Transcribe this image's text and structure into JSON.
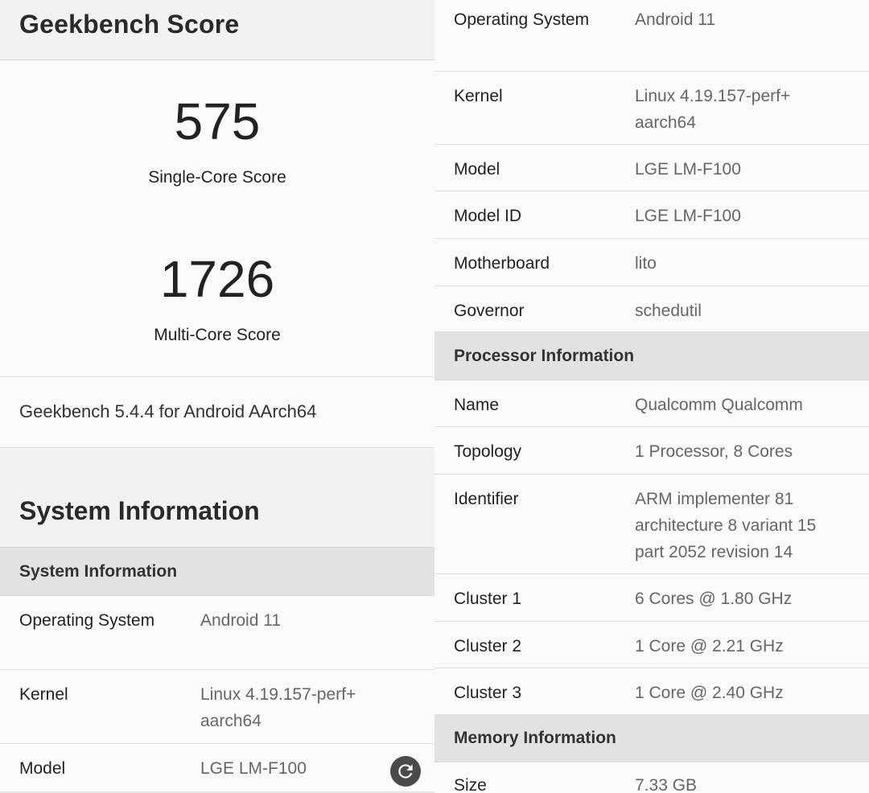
{
  "left": {
    "header_title": "Geekbench Score",
    "single_score": "575",
    "single_label": "Single-Core Score",
    "multi_score": "1726",
    "multi_label": "Multi-Core Score",
    "version": "Geekbench 5.4.4 for Android AArch64",
    "section_title": "System Information",
    "subheader": "System Information",
    "rows": [
      {
        "key": "Operating System",
        "value": "Android 11"
      },
      {
        "key": "Kernel",
        "value": "Linux 4.19.157-perf+ aarch64"
      },
      {
        "key": "Model",
        "value": "LGE LM-F100"
      }
    ]
  },
  "right": {
    "system_rows": [
      {
        "key": "Operating System",
        "value": "Android 11"
      },
      {
        "key": "Kernel",
        "value": "Linux 4.19.157-perf+ aarch64"
      },
      {
        "key": "Model",
        "value": "LGE LM-F100"
      },
      {
        "key": "Model ID",
        "value": "LGE LM-F100"
      },
      {
        "key": "Motherboard",
        "value": "lito"
      },
      {
        "key": "Governor",
        "value": "schedutil"
      }
    ],
    "processor_header": "Processor Information",
    "processor_rows": [
      {
        "key": "Name",
        "value": "Qualcomm Qualcomm"
      },
      {
        "key": "Topology",
        "value": "1 Processor, 8 Cores"
      },
      {
        "key": "Identifier",
        "value": "ARM implementer 81 architecture 8 variant 15 part 2052 revision 14"
      },
      {
        "key": "Cluster 1",
        "value": "6 Cores @ 1.80 GHz"
      },
      {
        "key": "Cluster 2",
        "value": "1 Core @ 2.21 GHz"
      },
      {
        "key": "Cluster 3",
        "value": "1 Core @ 2.40 GHz"
      }
    ],
    "memory_header": "Memory Information",
    "memory_rows": [
      {
        "key": "Size",
        "value": "7.33 GB"
      }
    ]
  },
  "icons": {
    "refresh": "refresh-icon"
  },
  "colors": {
    "subheader_bg": "#e2e2e2",
    "value_text": "#666666",
    "fab": "#4a4a4a"
  }
}
